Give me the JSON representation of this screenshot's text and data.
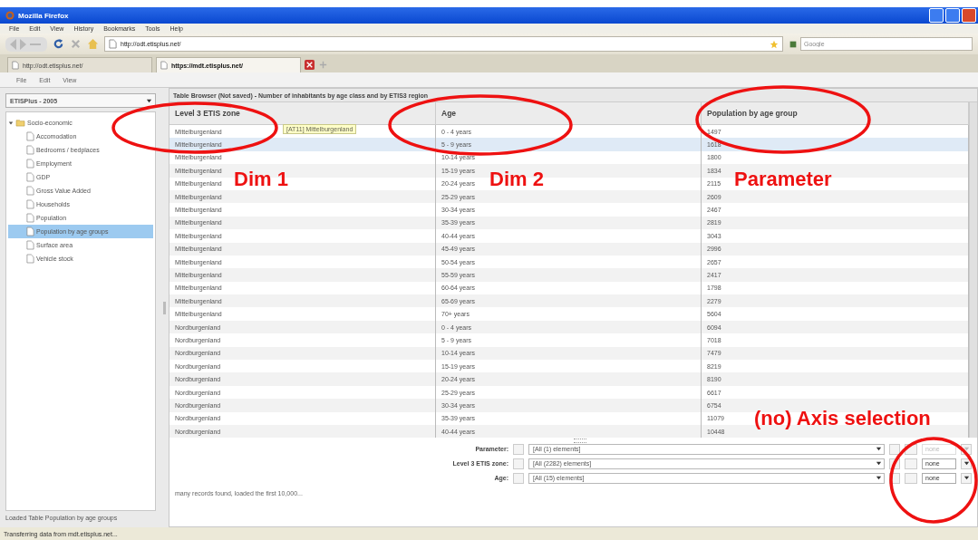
{
  "window": {
    "title": "Mozilla Firefox"
  },
  "menu": [
    "File",
    "Edit",
    "View",
    "History",
    "Bookmarks",
    "Tools",
    "Help"
  ],
  "address": {
    "value": "http://odt.etisplus.net/"
  },
  "search": {
    "placeholder": "Google"
  },
  "tabs": [
    {
      "label": "http://odt.etisplus.net/",
      "selected": false
    },
    {
      "label": "https://mdt.etisplus.net/",
      "selected": true
    }
  ],
  "app_menu": [
    "File",
    "Edit",
    "View"
  ],
  "dataset": {
    "value": "ETISPlus - 2005"
  },
  "tree": [
    {
      "label": "Socio-economic",
      "expanded": true,
      "selected": false,
      "children": [
        {
          "label": "Accomodation",
          "selected": false
        },
        {
          "label": "Bedrooms / bedplaces",
          "selected": false
        },
        {
          "label": "Employment",
          "selected": false
        },
        {
          "label": "GDP",
          "selected": false
        },
        {
          "label": "Gross Value Added",
          "selected": false
        },
        {
          "label": "Households",
          "selected": false
        },
        {
          "label": "Population",
          "selected": false
        },
        {
          "label": "Population by age groups",
          "selected": true
        },
        {
          "label": "Surface area",
          "selected": false
        },
        {
          "label": "Vehicle stock",
          "selected": false
        }
      ]
    }
  ],
  "sidebar_status": "Loaded Table Population by age groups",
  "panel_title": "Table Browser (Not saved) - Number of inhabitants by age class and by ETIS3 region",
  "table": {
    "columns": [
      "Level 3 ETIS zone",
      "Age",
      "Population by age group"
    ],
    "tooltip": "[AT11] Mittelburgenland",
    "rows": [
      {
        "cells": [
          "Mittelburgenland",
          "0 - 4 years",
          "1497"
        ],
        "selected": false
      },
      {
        "cells": [
          "Mittelburgenland",
          "5 - 9 years",
          "1618"
        ],
        "selected": true
      },
      {
        "cells": [
          "Mittelburgenland",
          "10-14 years",
          "1800"
        ],
        "selected": false
      },
      {
        "cells": [
          "Mittelburgenland",
          "15-19 years",
          "1834"
        ],
        "selected": false
      },
      {
        "cells": [
          "Mittelburgenland",
          "20-24 years",
          "2115"
        ],
        "selected": false
      },
      {
        "cells": [
          "Mittelburgenland",
          "25-29 years",
          "2609"
        ],
        "selected": false
      },
      {
        "cells": [
          "Mittelburgenland",
          "30-34 years",
          "2467"
        ],
        "selected": false
      },
      {
        "cells": [
          "Mittelburgenland",
          "35-39 years",
          "2819"
        ],
        "selected": false
      },
      {
        "cells": [
          "Mittelburgenland",
          "40-44 years",
          "3043"
        ],
        "selected": false
      },
      {
        "cells": [
          "Mittelburgenland",
          "45-49 years",
          "2996"
        ],
        "selected": false
      },
      {
        "cells": [
          "Mittelburgenland",
          "50-54 years",
          "2657"
        ],
        "selected": false
      },
      {
        "cells": [
          "Mittelburgenland",
          "55-59 years",
          "2417"
        ],
        "selected": false
      },
      {
        "cells": [
          "Mittelburgenland",
          "60-64 years",
          "1798"
        ],
        "selected": false
      },
      {
        "cells": [
          "Mittelburgenland",
          "65-69 years",
          "2279"
        ],
        "selected": false
      },
      {
        "cells": [
          "Mittelburgenland",
          "70+ years",
          "5604"
        ],
        "selected": false
      },
      {
        "cells": [
          "Nordburgenland",
          "0 - 4 years",
          "6094"
        ],
        "selected": false
      },
      {
        "cells": [
          "Nordburgenland",
          "5 - 9 years",
          "7018"
        ],
        "selected": false
      },
      {
        "cells": [
          "Nordburgenland",
          "10-14 years",
          "7479"
        ],
        "selected": false
      },
      {
        "cells": [
          "Nordburgenland",
          "15-19 years",
          "8219"
        ],
        "selected": false
      },
      {
        "cells": [
          "Nordburgenland",
          "20-24 years",
          "8190"
        ],
        "selected": false
      },
      {
        "cells": [
          "Nordburgenland",
          "25-29 years",
          "6617"
        ],
        "selected": false
      },
      {
        "cells": [
          "Nordburgenland",
          "30-34 years",
          "6754"
        ],
        "selected": false
      },
      {
        "cells": [
          "Nordburgenland",
          "35-39 years",
          "11079"
        ],
        "selected": false
      },
      {
        "cells": [
          "Nordburgenland",
          "40-44 years",
          "10448"
        ],
        "selected": false
      }
    ]
  },
  "filters": [
    {
      "label": "Parameter:",
      "value": "[All (1) elements]",
      "axis": "none",
      "axis_disabled": true
    },
    {
      "label": "Level 3 ETIS zone:",
      "value": "[All (2282) elements]",
      "axis": "none",
      "axis_disabled": false
    },
    {
      "label": "Age:",
      "value": "[All (15) elements]",
      "axis": "none",
      "axis_disabled": false
    }
  ],
  "panel_status": "many records found, loaded the first 10,000...",
  "status_bar": "Transferring data from mdt.etisplus.net...",
  "annotations": [
    {
      "text": "Dim 1"
    },
    {
      "text": "Dim 2"
    },
    {
      "text": "Parameter"
    },
    {
      "text": "(no) Axis selection"
    }
  ]
}
